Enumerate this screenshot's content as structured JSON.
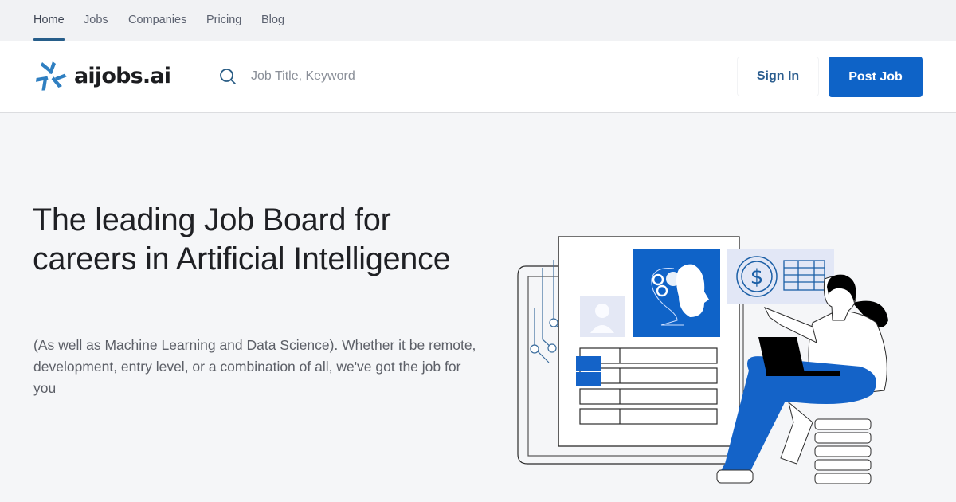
{
  "topnav": {
    "items": [
      {
        "label": "Home",
        "active": true
      },
      {
        "label": "Jobs",
        "active": false
      },
      {
        "label": "Companies",
        "active": false
      },
      {
        "label": "Pricing",
        "active": false
      },
      {
        "label": "Blog",
        "active": false
      }
    ]
  },
  "header": {
    "logo_text": "aijobs.ai",
    "logo_icon": "pinwheel-logo-icon",
    "search": {
      "icon": "search-icon",
      "placeholder": "Job Title, Keyword",
      "value": ""
    },
    "sign_in_label": "Sign In",
    "post_job_label": "Post Job"
  },
  "hero": {
    "title": "The leading Job Board for careers in Artificial Intelligence",
    "subtitle": "(As well as Machine Learning and Data Science). Whether it be remote, development, entry level, or a combination of all, we've got the job for you",
    "illustration": "woman-with-laptop-ai-job-board-illustration"
  },
  "colors": {
    "brand_blue": "#0e63c7",
    "nav_active_underline": "#275e8a",
    "logo_blue": "#2f7fc1",
    "signin_text": "#2b5d8f",
    "page_bg": "#f5f6f8",
    "topnav_bg": "#f1f2f4"
  }
}
